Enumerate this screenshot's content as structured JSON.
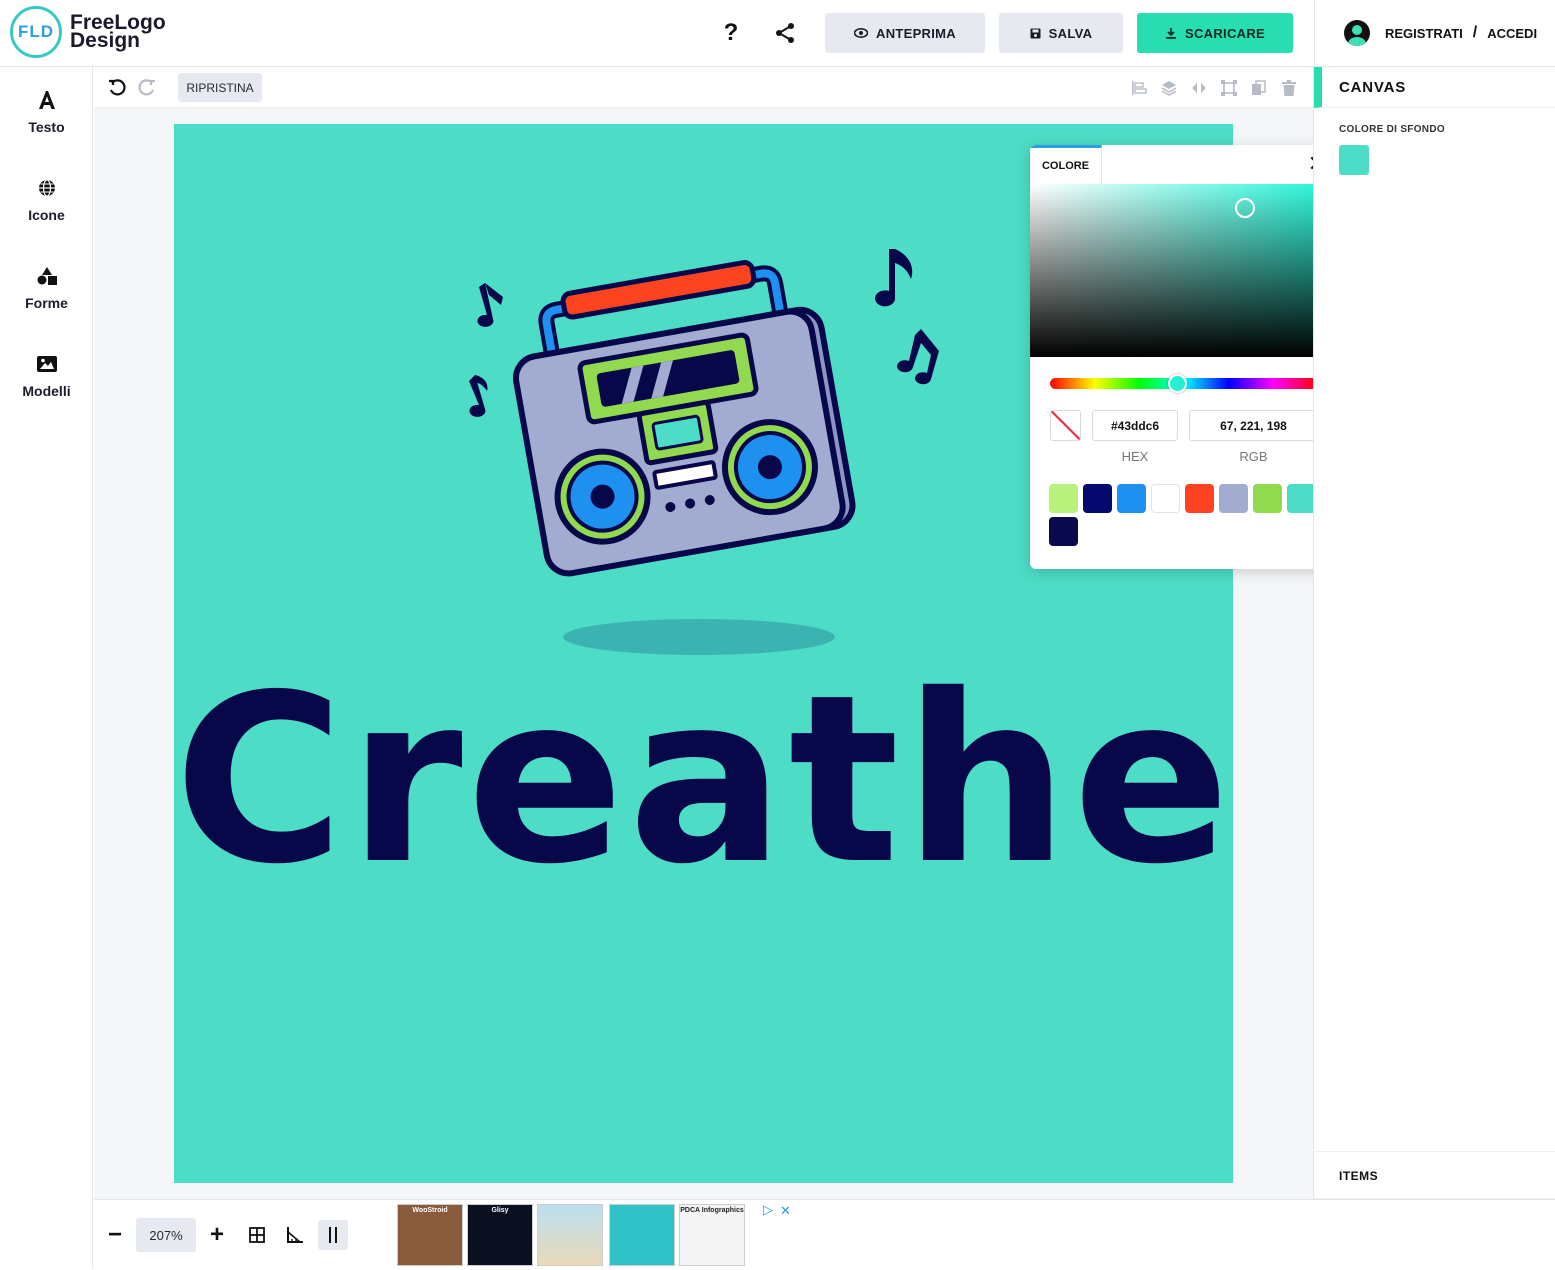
{
  "header": {
    "logo_badge": "FLD",
    "logo_line1": "FreeLogo",
    "logo_line2": "Design",
    "help_icon": "?",
    "preview_label": "ANTEPRIMA",
    "save_label": "SALVA",
    "download_label": "SCARICARE",
    "register_label": "REGISTRATI",
    "separator": "/",
    "login_label": "ACCEDI"
  },
  "sidebar": {
    "items": [
      {
        "label": "Testo",
        "icon": "text-icon"
      },
      {
        "label": "Icone",
        "icon": "globe-icon"
      },
      {
        "label": "Forme",
        "icon": "shapes-icon"
      },
      {
        "label": "Modelli",
        "icon": "image-icon"
      }
    ]
  },
  "toolbar": {
    "reset_label": "RIPRISTINA"
  },
  "canvas": {
    "background": "#4ddcc6",
    "brand_text": "Creathead",
    "brand_color": "#07074a"
  },
  "right_panel": {
    "title": "CANVAS",
    "bg_label": "COLORE DI SFONDO",
    "items_label": "ITEMS"
  },
  "color_picker": {
    "tab_label": "COLORE",
    "close_icon": "✕",
    "hex_value": "#43ddc6",
    "rgb_value": "67, 221, 198",
    "hex_label": "HEX",
    "rgb_label": "RGB",
    "swatches": [
      "#b8f27c",
      "#060a6e",
      "#1e90ef",
      "#ffffff",
      "#fc4421",
      "#a2acd0",
      "#91d94e",
      "#4ddcc6",
      "#0a0a4d"
    ]
  },
  "bottom": {
    "zoom": "207%",
    "minus": "−",
    "plus": "+",
    "ad_thumbs": [
      "WooStroid",
      "Glisy",
      "",
      "",
      "PDCA Infographics"
    ]
  }
}
